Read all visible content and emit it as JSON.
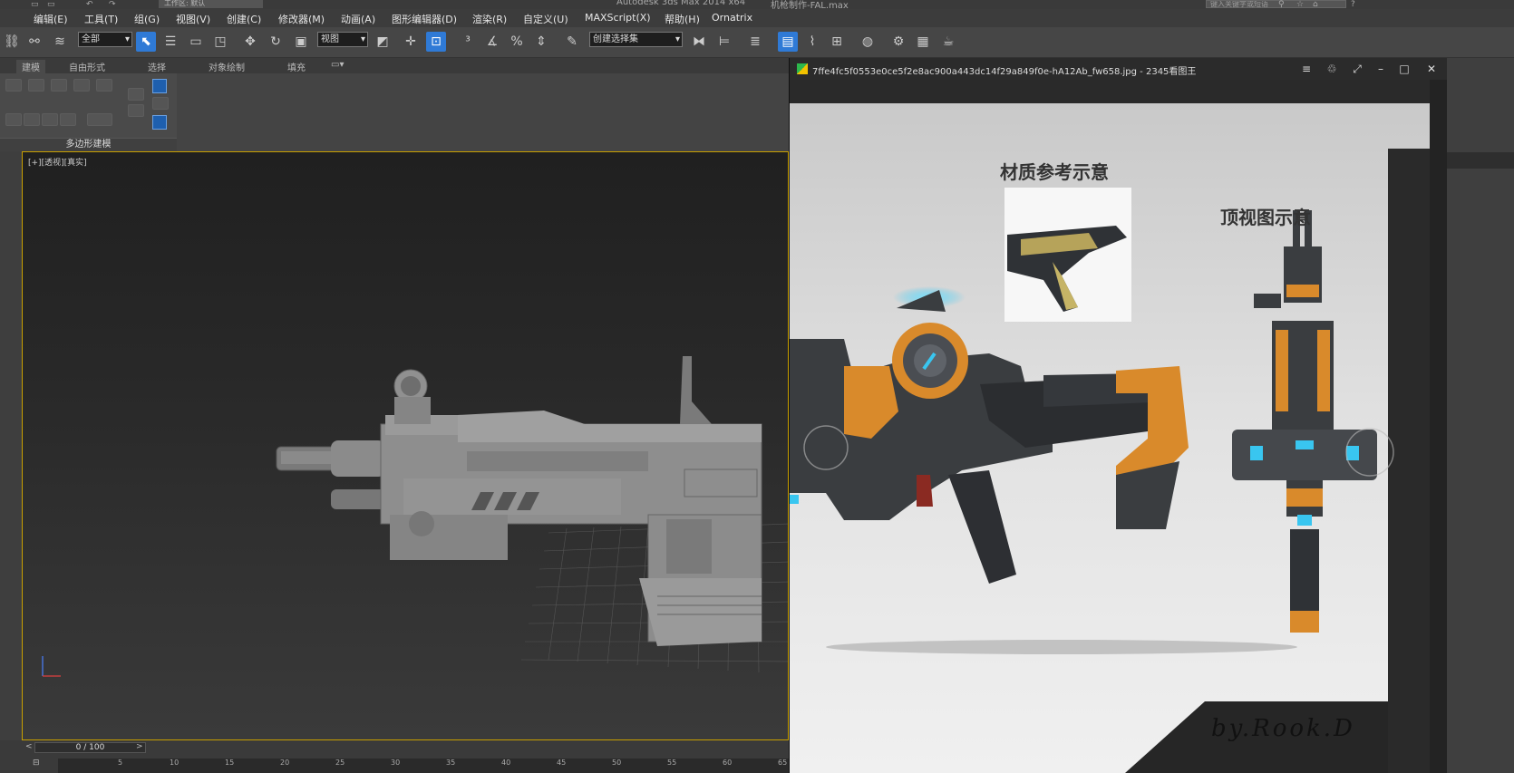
{
  "titlebar": {
    "app_title": "Autodesk 3ds Max  2014 x64",
    "file_name": "机枪制作-FAL.max",
    "workspace": "工作区: 默认",
    "search_placeholder": "键入关键字或短语"
  },
  "menu": [
    "编辑(E)",
    "工具(T)",
    "组(G)",
    "视图(V)",
    "创建(C)",
    "修改器(M)",
    "动画(A)",
    "图形编辑器(D)",
    "渲染(R)",
    "自定义(U)",
    "MAXScript(X)",
    "帮助(H)",
    "Ornatrix"
  ],
  "toolbar": {
    "selection_filter": "全部",
    "ref_coord": "视图",
    "named_selection": "创建选择集"
  },
  "ribbon": {
    "tabs": [
      "建模",
      "自由形式",
      "选择",
      "对象绘制",
      "填充"
    ],
    "group_label": "多边形建模"
  },
  "viewport": {
    "label": "[+][透视][真实]"
  },
  "timeline": {
    "frame": "0 / 100",
    "ticks": [
      "5",
      "10",
      "15",
      "20",
      "25",
      "30",
      "35",
      "40",
      "45",
      "50",
      "55",
      "60",
      "65"
    ]
  },
  "viewer": {
    "title": "7ffe4fc5f0553e0ce5f2e8ac900a443dc14f29a849f0e-hA12Ab_fw658.jpg - 2345看图王",
    "label_material": "材质参考示意",
    "label_topview": "顶视图示意",
    "signature": "by.Rook.D"
  },
  "colors": {
    "accent_blue": "#2f7ad6",
    "viewport_border": "#c9a000",
    "gun_orange": "#d98a2b",
    "gun_dark": "#3a3d40",
    "glow_cyan": "#39c6f0"
  }
}
